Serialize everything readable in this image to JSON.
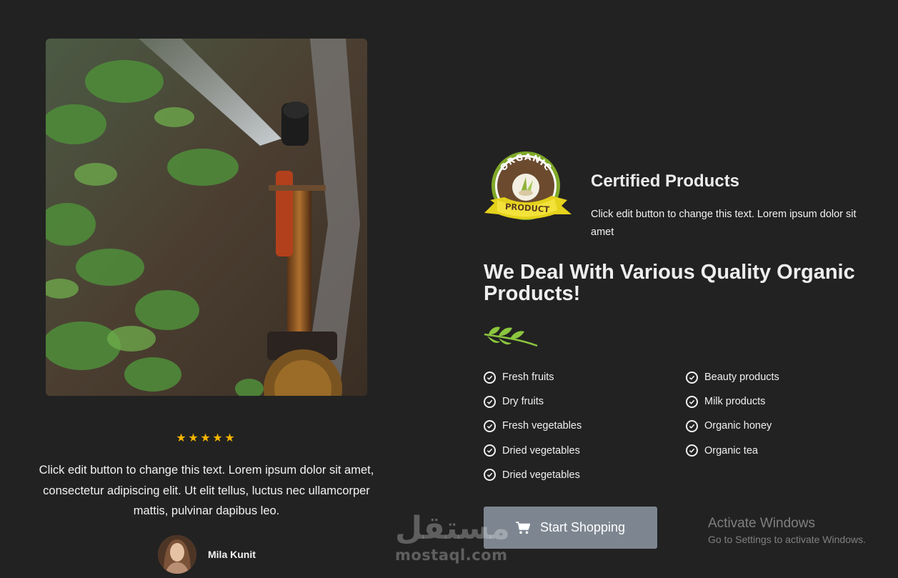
{
  "testimonial": {
    "rating": 5,
    "stars": [
      "★",
      "★",
      "★",
      "★",
      "★"
    ],
    "text": "Click edit button to change this text. Lorem ipsum dolor sit amet, consectetur adipiscing elit. Ut elit tellus, luctus nec ullamcorper mattis, pulvinar dapibus leo.",
    "author": "Mila Kunit"
  },
  "feature": {
    "badge_top": "ORGANIC",
    "badge_ribbon": "PRODUCT",
    "title": "Certified Products",
    "description": "Click edit button to change this text. Lorem ipsum dolor sit amet"
  },
  "heading": "We Deal With Various Quality Organic Products!",
  "product_list": {
    "col1": [
      "Fresh fruits",
      "Dry fruits",
      "Fresh vegetables",
      "Dried vegetables",
      "Dried vegetables"
    ],
    "col2": [
      "Beauty products",
      "Milk products",
      "Organic honey",
      "Organic tea"
    ]
  },
  "cta": {
    "label": "Start Shopping",
    "icon": "cart-icon"
  },
  "watermark": {
    "arabic": "مستقل",
    "latin": "mostaql.com"
  },
  "activate_windows": {
    "title": "Activate Windows",
    "subtitle": "Go to Settings to activate Windows."
  },
  "colors": {
    "background": "#222222",
    "button": "#7d8690",
    "star": "#f5b400",
    "leaf": "#8cc63f"
  }
}
